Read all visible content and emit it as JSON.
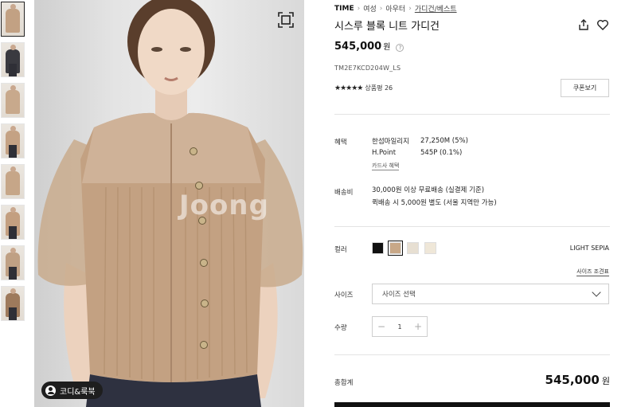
{
  "thumbnails": [
    {
      "body": "#c2a183",
      "legs": false
    },
    {
      "body": "#3a3a40",
      "legs": true
    },
    {
      "body": "#c8a98c",
      "legs": false
    },
    {
      "body": "#c4a284",
      "legs": true
    },
    {
      "body": "#c6a688",
      "legs": false
    },
    {
      "body": "#c39f80",
      "legs": true
    },
    {
      "body": "#bfa084",
      "legs": true
    },
    {
      "body": "#9e7a5c",
      "legs": true
    }
  ],
  "image": {
    "watermark": "Joong",
    "coordi_label": "코디&룩북",
    "zoom_icon": "expand-icon"
  },
  "breadcrumb": [
    "TIME",
    "여성",
    "아우터",
    "가디건/베스트"
  ],
  "product": {
    "title": "시스루 블록 니트 가디건",
    "price": "545,000",
    "price_unit": "원",
    "help": "?",
    "sku": "TM2E7KCD204W_LS",
    "stars": "★★★★★",
    "rating_label": "상품평 26",
    "coupon_label": "쿠폰보기"
  },
  "benefits": {
    "label": "혜택",
    "rows": [
      {
        "k": "한섬마일리지",
        "v": "27,250M (5%)"
      },
      {
        "k": "H.Point",
        "v": "545P (0.1%)"
      }
    ],
    "card_link": "카드사 혜택"
  },
  "shipping": {
    "label": "배송비",
    "lines": [
      "30,000원 이상 무료배송 (실결제 기준)",
      "퀵배송 시 5,000원 별도 (서울 지역만 가능)"
    ]
  },
  "color": {
    "label": "컬러",
    "swatches": [
      "#111111",
      "#c8a888",
      "#e7dfd2",
      "#efe7d8"
    ],
    "selected_index": 1,
    "selected_name": "LIGHT SEPIA"
  },
  "size": {
    "label": "사이즈",
    "placeholder": "사이즈 선택",
    "guide": "사이즈 조견표"
  },
  "quantity": {
    "label": "수량",
    "minus": "−",
    "value": "1",
    "plus": "+"
  },
  "total": {
    "label": "총합계",
    "amount": "545,000",
    "unit": "원"
  }
}
